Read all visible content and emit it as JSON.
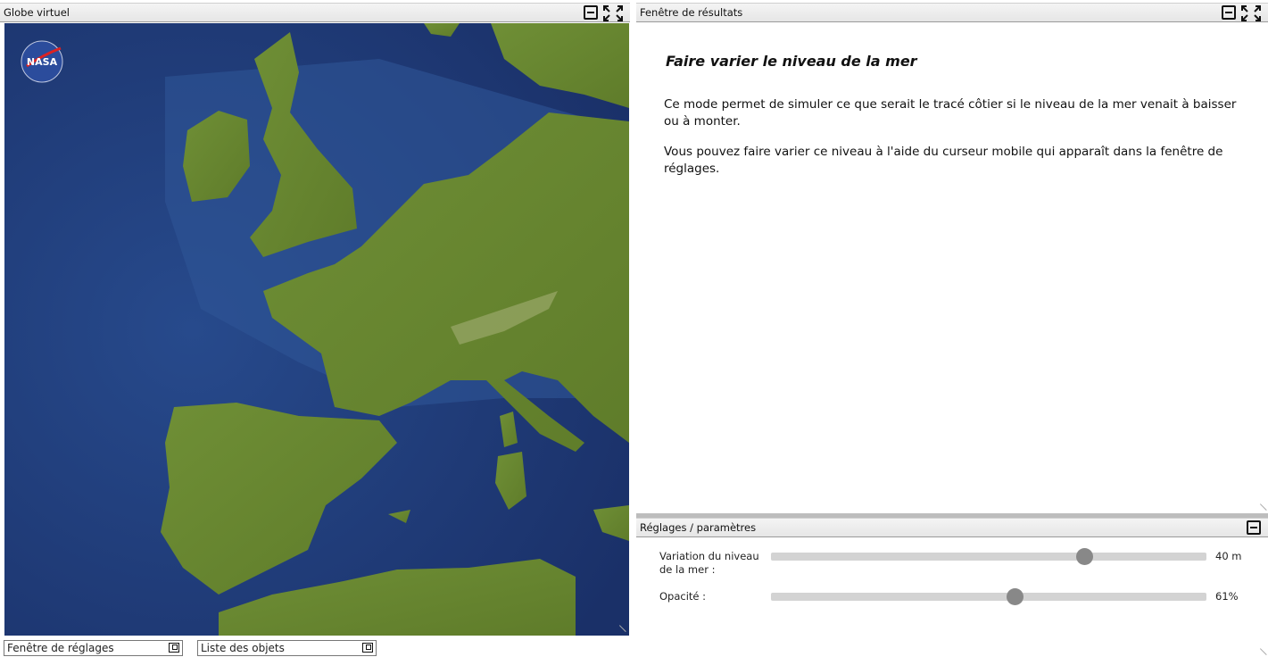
{
  "globe_panel": {
    "title": "Globe virtuel",
    "logo_text": "NASA"
  },
  "results_panel": {
    "title": "Fenêtre de résultats",
    "heading": "Faire varier le niveau de la mer",
    "paragraphs": [
      "Ce mode permet de simuler ce que serait le tracé côtier si le niveau de la mer venait à baisser ou à monter.",
      "Vous pouvez faire varier ce niveau à l'aide du curseur mobile qui apparaît dans la fenêtre de réglages."
    ]
  },
  "settings_panel": {
    "title": "Réglages / paramètres",
    "sea_level": {
      "label": "Variation du niveau de la mer :",
      "value": "40 m",
      "position_fraction": 0.72
    },
    "opacity": {
      "label": "Opacité :",
      "value": "61%",
      "position_fraction": 0.56
    }
  },
  "minimized": {
    "settings_window": "Fenêtre de réglages",
    "objects_list": "Liste des objets"
  },
  "colors": {
    "ocean": "#1f3a78",
    "land": "#6b8a32",
    "slider_track": "#d3d3d3",
    "slider_thumb": "#888888"
  },
  "icons": {
    "minimize": "minimize-icon",
    "maximize": "maximize-icon",
    "restore": "restore-icon"
  }
}
